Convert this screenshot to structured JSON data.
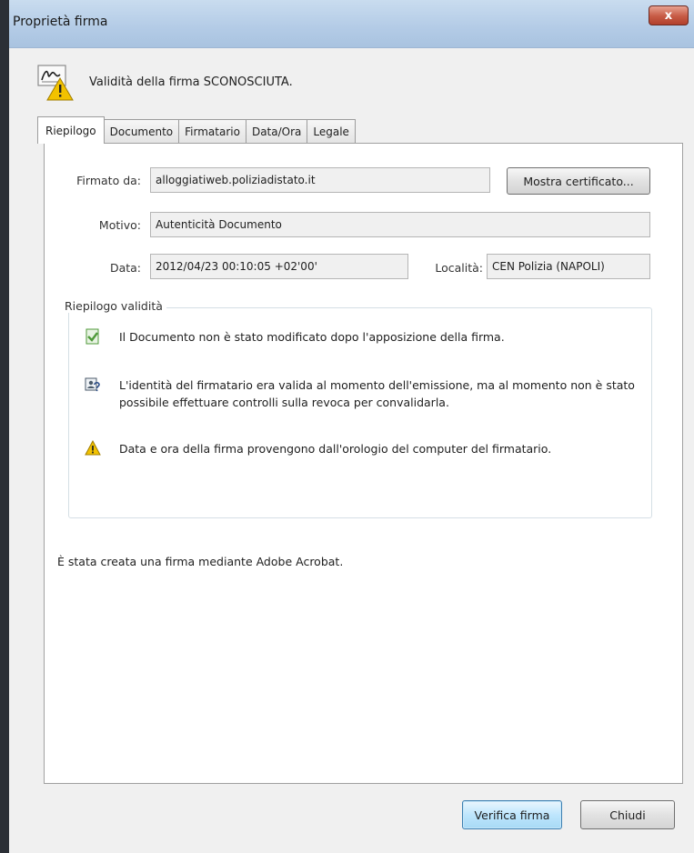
{
  "window": {
    "title": "Proprietà firma",
    "close_label": "x"
  },
  "header": {
    "text": "Validità della firma SCONOSCIUTA."
  },
  "tabs": [
    {
      "label": "Riepilogo",
      "active": true
    },
    {
      "label": "Documento",
      "active": false
    },
    {
      "label": "Firmatario",
      "active": false
    },
    {
      "label": "Data/Ora",
      "active": false
    },
    {
      "label": "Legale",
      "active": false
    }
  ],
  "fields": {
    "signed_by_label": "Firmato da:",
    "signed_by_value": "alloggiatiweb.poliziadistato.it",
    "show_certificate_label": "Mostra certificato...",
    "reason_label": "Motivo:",
    "reason_value": "Autenticità Documento",
    "date_label": "Data:",
    "date_value": "2012/04/23 00:10:05 +02'00'",
    "location_label": "Località:",
    "location_value": "CEN Polizia (NAPOLI)"
  },
  "validity": {
    "title": "Riepilogo validità",
    "items": [
      {
        "icon": "document-check-icon",
        "text": "Il Documento non è stato modificato dopo l'apposizione della firma."
      },
      {
        "icon": "signer-question-icon",
        "text": "L'identità del firmatario era valida al momento dell'emissione, ma al momento non è stato possibile effettuare controlli sulla revoca per convalidarla."
      },
      {
        "icon": "warning-icon",
        "text": "Data e ora della firma provengono dall'orologio del computer del firmatario."
      }
    ]
  },
  "note": "È stata creata una firma mediante Adobe Acrobat.",
  "buttons": {
    "verify_label": "Verifica firma",
    "close_label": "Chiudi"
  },
  "colors": {
    "warning": "#f2c200",
    "check_green": "#4f9a3a",
    "title_bar": "#b3cbe6"
  }
}
